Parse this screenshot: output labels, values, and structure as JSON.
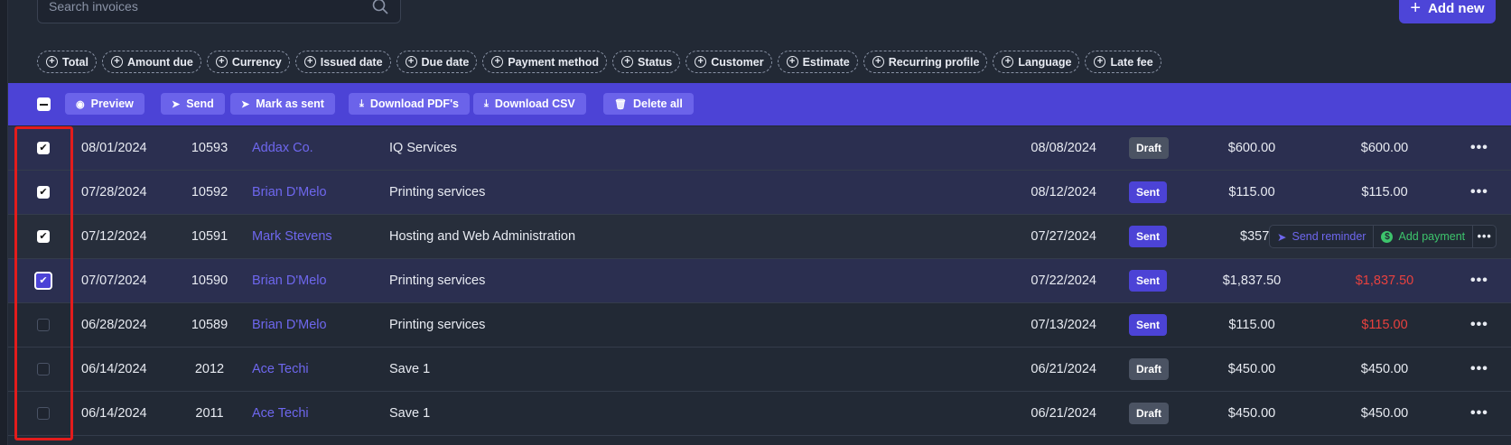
{
  "search": {
    "placeholder": "Search invoices"
  },
  "add_new_label": "Add new",
  "filters": [
    "Total",
    "Amount due",
    "Currency",
    "Issued date",
    "Due date",
    "Payment method",
    "Status",
    "Customer",
    "Estimate",
    "Recurring profile",
    "Language",
    "Late fee"
  ],
  "toolbar": {
    "preview": "Preview",
    "send": "Send",
    "mark_as_sent": "Mark as sent",
    "download_pdfs": "Download PDF's",
    "download_csv": "Download CSV",
    "delete_all": "Delete all"
  },
  "hover_actions": {
    "send_reminder": "Send reminder",
    "add_payment": "Add payment"
  },
  "rows": [
    {
      "checked": true,
      "date": "08/01/2024",
      "number": "10593",
      "customer": "Addax Co.",
      "description": "IQ Services",
      "due_date": "08/08/2024",
      "status": "Draft",
      "total": "$600.00",
      "amount_due": "$600.00",
      "overdue": false
    },
    {
      "checked": true,
      "date": "07/28/2024",
      "number": "10592",
      "customer": "Brian D'Melo",
      "description": "Printing services",
      "due_date": "08/12/2024",
      "status": "Sent",
      "total": "$115.00",
      "amount_due": "$115.00",
      "overdue": false
    },
    {
      "checked": true,
      "date": "07/12/2024",
      "number": "10591",
      "customer": "Mark Stevens",
      "description": "Hosting and Web Administration",
      "due_date": "07/27/2024",
      "status": "Sent",
      "total": "$357.0",
      "amount_due": "",
      "overdue": false
    },
    {
      "checked": true,
      "date": "07/07/2024",
      "number": "10590",
      "customer": "Brian D'Melo",
      "description": "Printing services",
      "due_date": "07/22/2024",
      "status": "Sent",
      "total": "$1,837.50",
      "amount_due": "$1,837.50",
      "overdue": true
    },
    {
      "checked": false,
      "date": "06/28/2024",
      "number": "10589",
      "customer": "Brian D'Melo",
      "description": "Printing services",
      "due_date": "07/13/2024",
      "status": "Sent",
      "total": "$115.00",
      "amount_due": "$115.00",
      "overdue": true
    },
    {
      "checked": false,
      "date": "06/14/2024",
      "number": "2012",
      "customer": "Ace Techi",
      "description": "Save 1",
      "due_date": "06/21/2024",
      "status": "Draft",
      "total": "$450.00",
      "amount_due": "$450.00",
      "overdue": false
    },
    {
      "checked": false,
      "date": "06/14/2024",
      "number": "2011",
      "customer": "Ace Techi",
      "description": "Save 1",
      "due_date": "06/21/2024",
      "status": "Draft",
      "total": "$450.00",
      "amount_due": "$450.00",
      "overdue": false
    }
  ],
  "colors": {
    "accent": "#4c43d6",
    "link": "#6e67ee",
    "overdue": "#e8413e",
    "highlight": "#e31c1c",
    "payment": "#3dc46c"
  }
}
